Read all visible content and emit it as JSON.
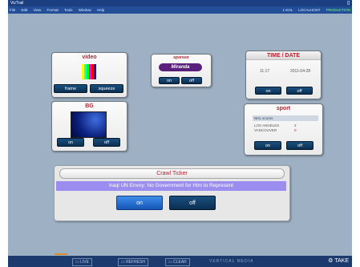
{
  "window": {
    "title": "VizTrail",
    "controls": "[]"
  },
  "menu": {
    "items": [
      "File",
      "Edit",
      "View",
      "Format",
      "Tools",
      "Window",
      "Help"
    ]
  },
  "status": {
    "items": [
      "1 EOL",
      "LOCALHOST"
    ],
    "production_label": "PRODUCTION"
  },
  "panels": {
    "video": {
      "title": "video",
      "buttons": [
        "frame",
        "squeeze"
      ]
    },
    "sponsor": {
      "title": "sponsor",
      "logo_text": "Miranda",
      "buttons": [
        "on",
        "off"
      ]
    },
    "timedate": {
      "title": "TIME / DATE",
      "time": "11:17",
      "date": "2011-04-28",
      "buttons": [
        "on",
        "off"
      ]
    },
    "bg": {
      "title": "BG",
      "buttons": [
        "on",
        "off"
      ]
    },
    "sport": {
      "title": "sport",
      "header": "NHL scores",
      "rows": [
        {
          "team": "LOS ANGELES",
          "score": "2"
        },
        {
          "team": "VANCOUVER",
          "score": "0"
        }
      ],
      "buttons": [
        "on",
        "off"
      ]
    },
    "crawl": {
      "title": "Crawl Ticker",
      "text": "Iraqi UN Envoy: No Government for Him to Represent",
      "buttons": [
        "on",
        "off"
      ]
    }
  },
  "footer": {
    "buttons": [
      "LIVE",
      "REFRESH",
      "CLEAR"
    ],
    "brand": "VERTICAL MEDIA",
    "take_label": "TAKE"
  }
}
